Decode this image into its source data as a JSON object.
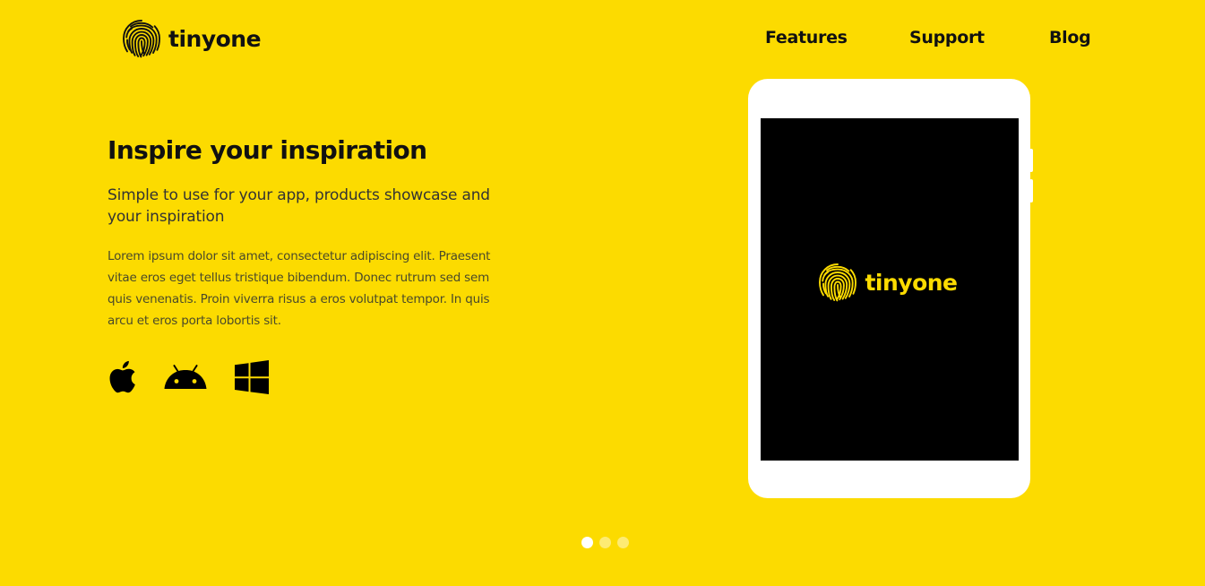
{
  "brand": {
    "name": "tinyone",
    "icon": "fingerprint-icon"
  },
  "nav": {
    "items": [
      {
        "label": "Features"
      },
      {
        "label": "Support"
      },
      {
        "label": "Blog"
      }
    ]
  },
  "hero": {
    "title": "Inspire your inspiration",
    "subtitle": "Simple to use for your app, products showcase and your inspiration",
    "body": "Lorem ipsum dolor sit amet, consectetur adipiscing elit. Praesent vitae eros eget tellus tristique bibendum. Donec rutrum sed sem quis venenatis. Proin viverra risus a eros volutpat tempor. In quis arcu et eros porta lobortis sit.",
    "platforms": [
      "apple-icon",
      "android-icon",
      "windows-icon"
    ]
  },
  "device": {
    "screen_brand": "tinyone"
  },
  "carousel": {
    "slide_count": 3,
    "active_index": 0
  },
  "colors": {
    "background": "#fcdb00",
    "text": "#111111",
    "screen": "#000000",
    "device": "#ffffff"
  }
}
